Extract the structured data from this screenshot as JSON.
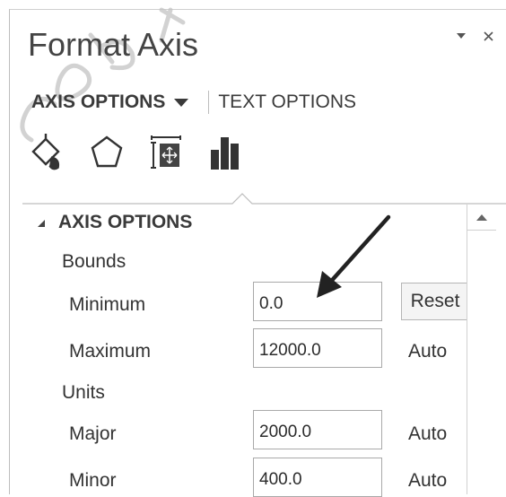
{
  "pane": {
    "title": "Format Axis",
    "dropdown_icon": "dropdown-arrow-icon",
    "close_icon": "close-icon"
  },
  "tabs": {
    "axis_options": "AXIS OPTIONS",
    "text_options": "TEXT OPTIONS"
  },
  "icon_tabs": [
    {
      "name": "fill-line-icon"
    },
    {
      "name": "effects-icon"
    },
    {
      "name": "size-properties-icon"
    },
    {
      "name": "axis-options-icon"
    }
  ],
  "section": {
    "title": "AXIS OPTIONS",
    "bounds_label": "Bounds",
    "units_label": "Units",
    "rows": [
      {
        "label": "Minimum",
        "value": "0.0",
        "action": "Reset"
      },
      {
        "label": "Maximum",
        "value": "12000.0",
        "action": "Auto"
      },
      {
        "label": "Major",
        "value": "2000.0",
        "action": "Auto"
      },
      {
        "label": "Minor",
        "value": "400.0",
        "action": "Auto"
      }
    ]
  },
  "colors": {
    "text": "#2b2b2b",
    "border": "#a9a9a9",
    "watermark": "#c0c0c0"
  }
}
